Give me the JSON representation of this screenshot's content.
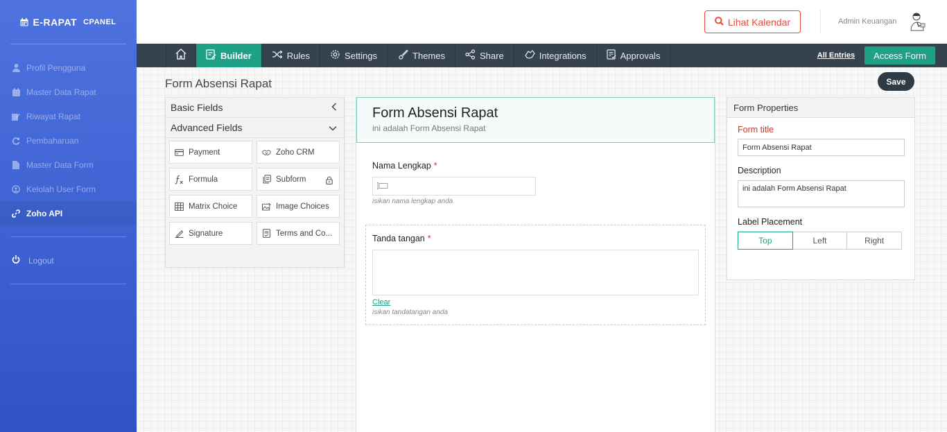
{
  "sidebar": {
    "brand": {
      "title": "E-RAPAT",
      "subtitle": "CPANEL",
      "icon": "calendar-icon"
    },
    "items": [
      {
        "label": "Profil Pengguna",
        "icon": "user-icon",
        "active": false
      },
      {
        "label": "Master Data Rapat",
        "icon": "calendar-icon",
        "active": false
      },
      {
        "label": "Riwayat Rapat",
        "icon": "edit-icon",
        "active": false
      },
      {
        "label": "Pembaharuan",
        "icon": "refresh-icon",
        "active": false
      },
      {
        "label": "Master Data Form",
        "icon": "file-icon",
        "active": false
      },
      {
        "label": "Kelolah User Form",
        "icon": "user-circle-icon",
        "active": false
      },
      {
        "label": "Zoho API",
        "icon": "link-icon",
        "active": true
      }
    ],
    "logout": "Logout"
  },
  "header": {
    "calendar_button": "Lihat Kalendar",
    "user_name": "Admin Keuangan"
  },
  "toolbar": {
    "items": [
      {
        "label": "Builder",
        "active": true
      },
      {
        "label": "Rules"
      },
      {
        "label": "Settings"
      },
      {
        "label": "Themes"
      },
      {
        "label": "Share"
      },
      {
        "label": "Integrations"
      },
      {
        "label": "Approvals"
      }
    ],
    "all_entries": "All Entries",
    "access_form": "Access Form"
  },
  "builder": {
    "page_title": "Form Absensi Rapat",
    "save": "Save",
    "basic_fields": "Basic Fields",
    "advanced_fields": "Advanced Fields",
    "fields": [
      {
        "label": "Payment",
        "icon": "payment-icon"
      },
      {
        "label": "Zoho CRM",
        "icon": "handshake-icon"
      },
      {
        "label": "Formula",
        "icon": "formula-icon"
      },
      {
        "label": "Subform",
        "icon": "subform-icon"
      },
      {
        "label": "Matrix Choice",
        "icon": "grid-icon"
      },
      {
        "label": "Image Choices",
        "icon": "image-icon"
      },
      {
        "label": "Signature",
        "icon": "signature-icon"
      },
      {
        "label": "Terms and Co...",
        "icon": "terms-icon"
      }
    ]
  },
  "form": {
    "title": "Form Absensi Rapat",
    "description": "ini adalah Form Absensi Rapat",
    "fields": [
      {
        "label": "Nama Lengkap",
        "required": "*",
        "hint": "isikan nama lengkap anda"
      },
      {
        "label": "Tanda tangan",
        "required": "*",
        "clear": "Clear",
        "hint": "isikan tandatangan anda"
      }
    ]
  },
  "properties": {
    "title": "Form Properties",
    "form_title_label": "Form title",
    "form_title_value": "Form Absensi Rapat",
    "description_label": "Description",
    "description_value": "ini adalah Form Absensi Rapat",
    "label_placement": "Label Placement",
    "placements": [
      "Top",
      "Left",
      "Right"
    ],
    "selected_placement": "Top"
  },
  "colors": {
    "sidebar_top": "#4e73df",
    "accent_green": "#1fa187",
    "toolbar_bg": "#36434e",
    "danger": "#e74a3b"
  }
}
